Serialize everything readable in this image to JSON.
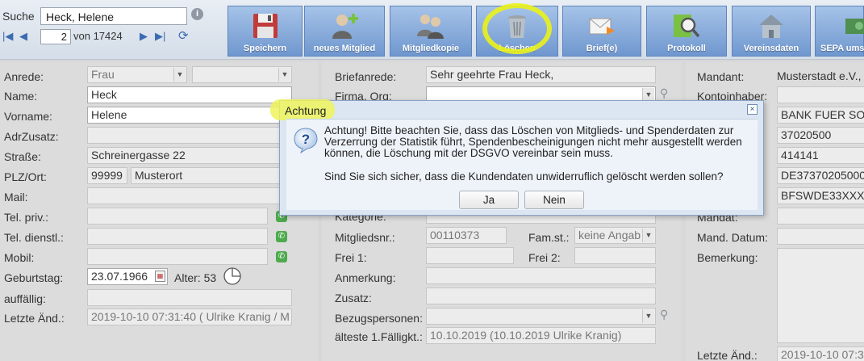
{
  "search": {
    "label": "Suche",
    "value": "Heck, Helene"
  },
  "pager": {
    "current": "2",
    "of_text": "von 17424"
  },
  "toolbar": [
    {
      "label": "Speichern",
      "icon": "floppy-disk"
    },
    {
      "label": "neues Mitglied",
      "icon": "add-person"
    },
    {
      "label": "Mitgliedkopie",
      "icon": "two-persons"
    },
    {
      "label": "Löschen",
      "icon": "trash-can"
    },
    {
      "label": "Brief(e)",
      "icon": "envelope"
    },
    {
      "label": "Protokoll",
      "icon": "magnifier-chart"
    },
    {
      "label": "Vereinsdaten",
      "icon": "house"
    },
    {
      "label": "SEPA ums",
      "icon": "banknote"
    }
  ],
  "left": {
    "anrede": {
      "label": "Anrede:",
      "value": "Frau"
    },
    "name": {
      "label": "Name:",
      "value": "Heck"
    },
    "vorname": {
      "label": "Vorname:",
      "value": "Helene"
    },
    "adrzusatz": {
      "label": "AdrZusatz:",
      "value": ""
    },
    "strasse": {
      "label": "Straße:",
      "value": "Schreinergasse 22"
    },
    "plzort": {
      "label": "PLZ/Ort:",
      "plz": "99999",
      "ort": "Musterort"
    },
    "mail": {
      "label": "Mail:",
      "value": ""
    },
    "telpriv": {
      "label": "Tel. priv.:",
      "value": ""
    },
    "teldienst": {
      "label": "Tel. dienstl.:",
      "value": ""
    },
    "mobil": {
      "label": "Mobil:",
      "value": ""
    },
    "geburtstag": {
      "label": "Geburtstag:",
      "value": "23.07.1966",
      "alter": "Alter: 53"
    },
    "auffaellig": {
      "label": "auffällig:",
      "value": ""
    },
    "letzte": {
      "label": "Letzte Änd.:",
      "value": "2019-10-10 07:31:40 ( Ulrike Kranig / M"
    }
  },
  "middle": {
    "briefanrede": {
      "label": "Briefanrede:",
      "value": "Sehr geehrte Frau Heck,"
    },
    "firma": {
      "label": "Firma, Org:",
      "value": ""
    },
    "kategorie": {
      "label": "Kategorie:",
      "value": ""
    },
    "mitgliedsnr": {
      "label": "Mitgliedsnr.:",
      "value": "00110373"
    },
    "famst": {
      "label": "Fam.st.:",
      "value": "keine Angab"
    },
    "frei1": {
      "label": "Frei 1:",
      "value": ""
    },
    "frei2": {
      "label": "Frei 2:",
      "value": ""
    },
    "anmerkung": {
      "label": "Anmerkung:",
      "value": ""
    },
    "zusatz": {
      "label": "Zusatz:",
      "value": ""
    },
    "bezugspersonen": {
      "label": "Bezugspersonen:",
      "value": ""
    },
    "faelligkeit": {
      "label": "älteste 1.Fälligkt.:",
      "value": "10.10.2019 (10.10.2019 Ulrike Kranig)"
    }
  },
  "right": {
    "mandant": {
      "label": "Mandant:",
      "value": "Musterstadt e.V.,"
    },
    "kontoinhaber": {
      "label": "Kontoinhaber:",
      "value": ""
    },
    "bank": "BANK FUER SOZI",
    "blz": "37020500",
    "konto": "414141",
    "iban": "DE373702050000",
    "bic": "BFSWDE33XXX",
    "mandat": {
      "label": "Mandat:",
      "value": ""
    },
    "manddatum": {
      "label": "Mand. Datum:",
      "value": ""
    },
    "bemerkung": {
      "label": "Bemerkung:",
      "value": ""
    },
    "letzte": {
      "label": "Letzte Änd.:",
      "value": "2019-10-10 07:3"
    }
  },
  "dialog": {
    "title": "Achtung",
    "close": "×",
    "message": "Achtung! Bitte beachten Sie, dass das Löschen von Mitglieds- und Spenderdaten zur Verzerrung der Statistik führt, Spendenbescheinigungen nicht mehr ausgestellt werden können, die Löschung mit der DSGVO vereinbar sein muss.",
    "question": "Sind Sie sich sicher, dass die Kundendaten unwiderruflich gelöscht werden sollen?",
    "yes": "Ja",
    "no": "Nein"
  },
  "colors": {
    "toolbar": "#7aa0d4",
    "highlight": "#eaf21a",
    "phone": "#4daa4d"
  }
}
